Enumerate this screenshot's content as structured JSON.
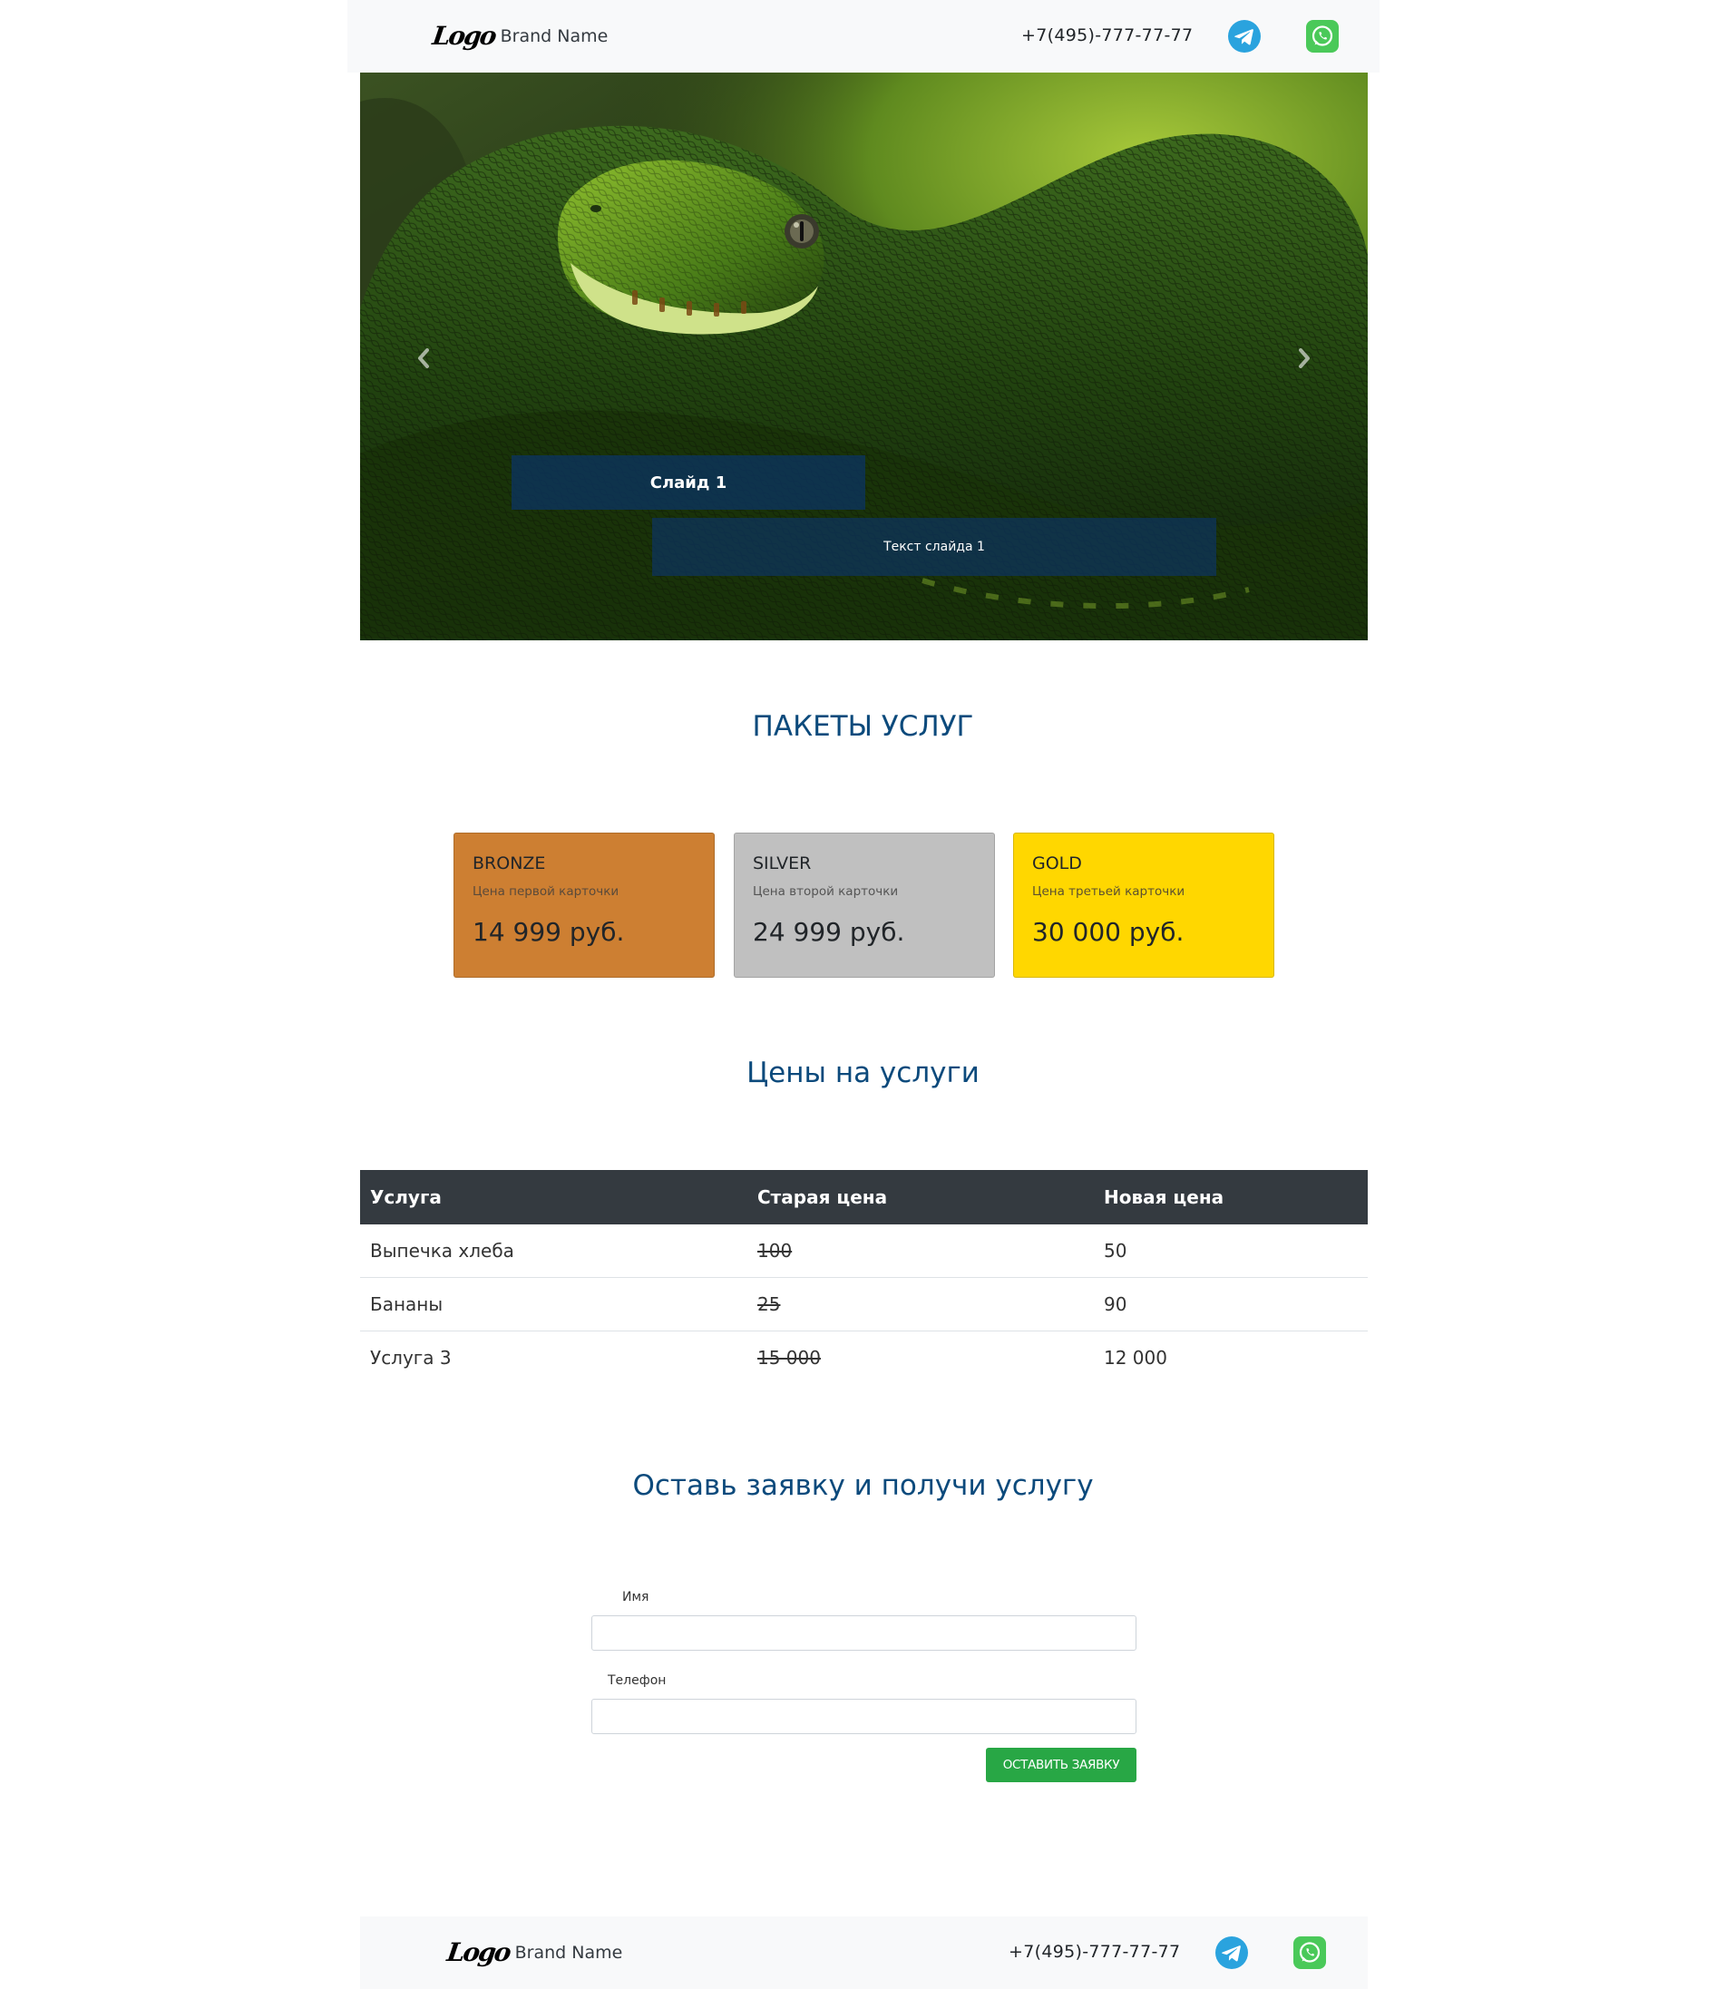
{
  "header": {
    "logo_text": "Logo",
    "brand_name": "Brand Name",
    "phone": "+7(495)-777-77-77",
    "telegram_color": "#2aa3de",
    "whatsapp_color": "#4ac959"
  },
  "carousel": {
    "slide_title": "Слайд 1",
    "slide_text": "Текст слайда 1"
  },
  "packages": {
    "title": "ПАКЕТЫ УСЛУГ",
    "cards": [
      {
        "name": "BRONZE",
        "subtitle": "Цена первой карточки",
        "price": "14 999 руб.",
        "color": "#cd7f32"
      },
      {
        "name": "SILVER",
        "subtitle": "Цена второй карточки",
        "price": "24 999 руб.",
        "color": "#c0c0c0"
      },
      {
        "name": "GOLD",
        "subtitle": "Цена третьей карточки",
        "price": "30 000 руб.",
        "color": "#ffd700"
      }
    ]
  },
  "prices": {
    "title": "Цены на услуги",
    "columns": [
      "Услуга",
      "Старая цена",
      "Новая цена"
    ],
    "rows": [
      {
        "service": "Выпечка хлеба",
        "old": "100",
        "new": "50"
      },
      {
        "service": "Бананы",
        "old": "25",
        "new": "90"
      },
      {
        "service": "Услуга 3",
        "old": "15 000",
        "new": "12 000"
      }
    ]
  },
  "form": {
    "title": "Оставь заявку и получи услугу",
    "name_label": "Имя",
    "phone_label": "Телефон",
    "submit_label": "Оставить заявку",
    "accent_color": "#28a745"
  },
  "footer": {
    "logo_text": "Logo",
    "brand_name": "Brand Name",
    "phone": "+7(495)-777-77-77"
  },
  "colors": {
    "heading": "#0c4a7c",
    "table_header": "#343a40",
    "bar_background": "#f8f9fa"
  }
}
